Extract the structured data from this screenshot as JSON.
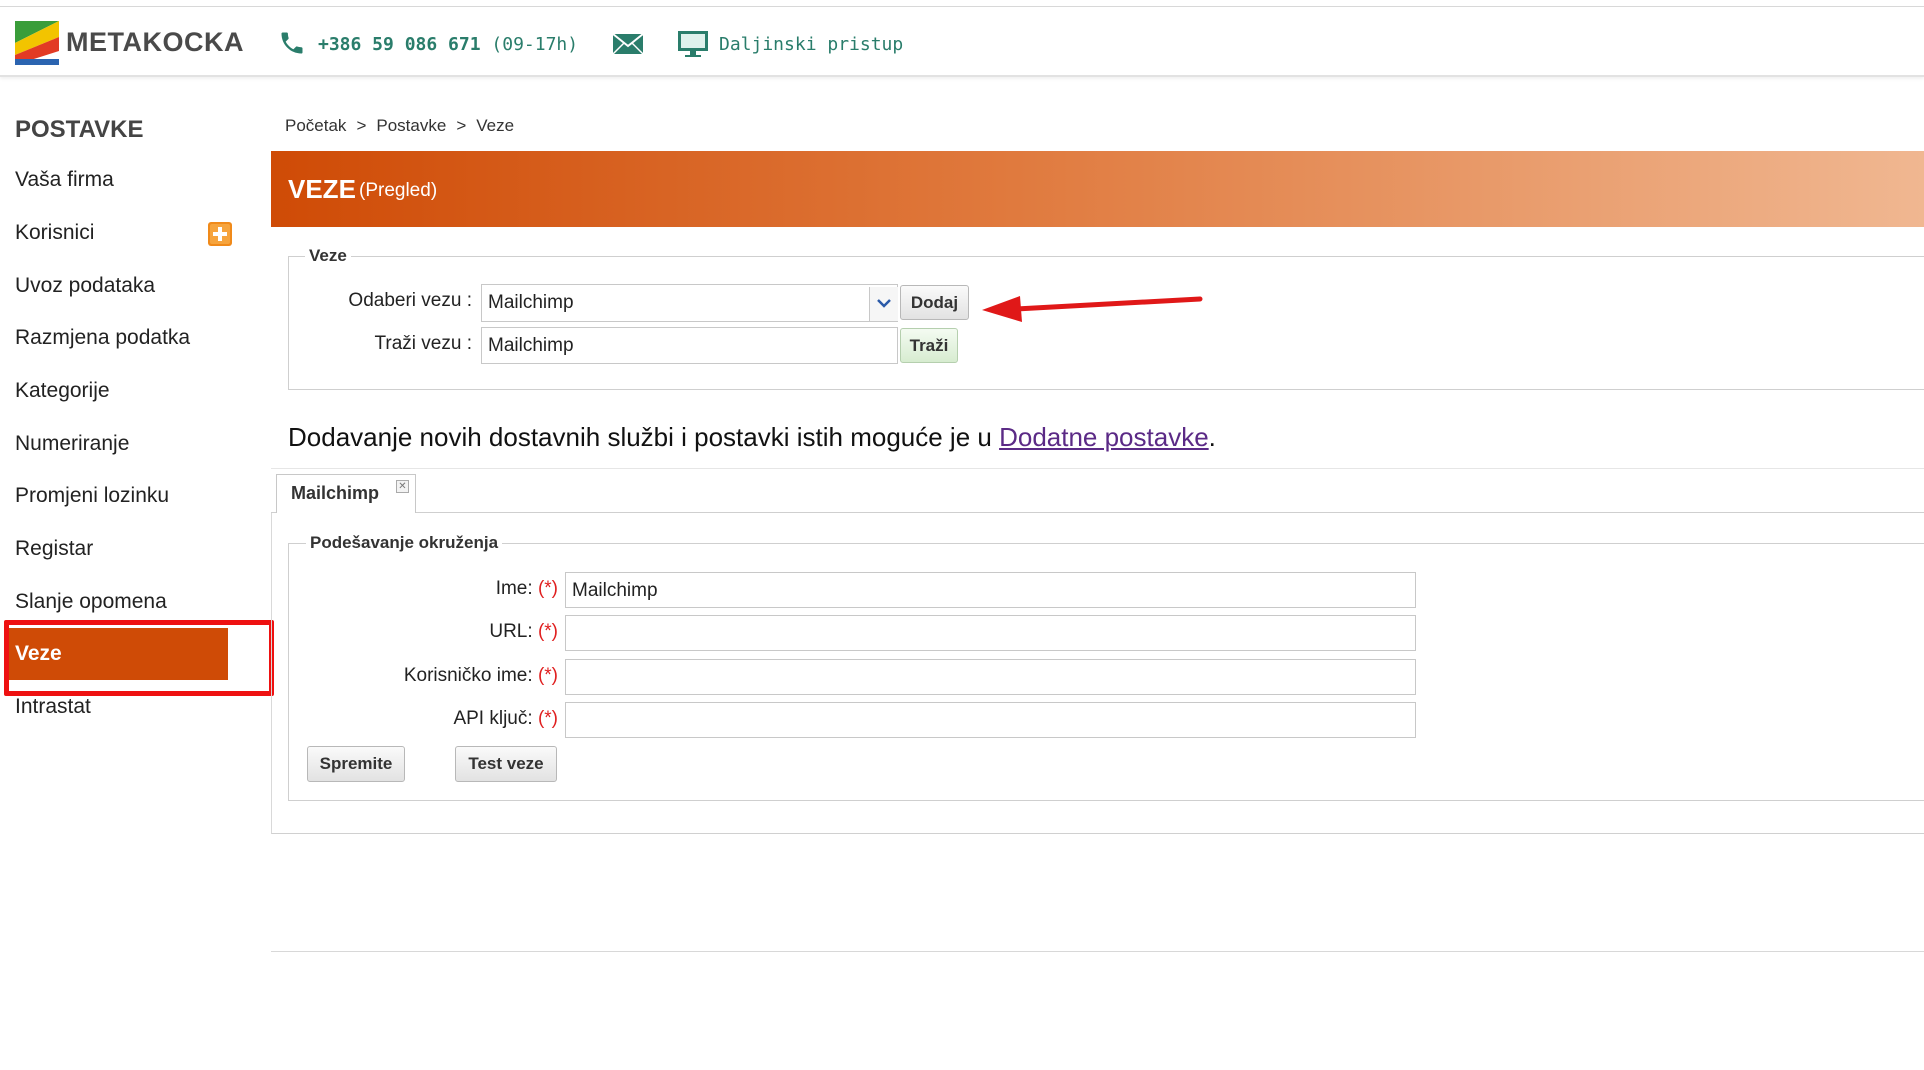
{
  "header": {
    "logo_text": "METAKOCKA",
    "phone": "+386 59 086 671",
    "phone_hours": "(09-17h)",
    "remote_label": "Daljinski pristup",
    "accent_color": "#2a7d6b"
  },
  "sidebar": {
    "title": "POSTAVKE",
    "items": [
      {
        "label": "Vaša firma"
      },
      {
        "label": "Korisnici",
        "icon": "plus-icon"
      },
      {
        "label": "Uvoz podataka"
      },
      {
        "label": "Razmjena podatka"
      },
      {
        "label": "Kategorije"
      },
      {
        "label": "Numeriranje"
      },
      {
        "label": "Promjeni lozinku"
      },
      {
        "label": "Registar"
      },
      {
        "label": "Slanje opomena"
      },
      {
        "label": "Veze",
        "active": true
      },
      {
        "label": "Intrastat"
      }
    ],
    "active_color": "#cf4b06"
  },
  "breadcrumb": [
    "Početak",
    "Postavke",
    "Veze"
  ],
  "banner": {
    "title": "VEZE",
    "subtitle": "(Pregled)"
  },
  "veze_section": {
    "legend": "Veze",
    "select_label": "Odaberi vezu :",
    "select_value": "Mailchimp",
    "add_button": "Dodaj",
    "search_label": "Traži vezu :",
    "search_value": "Mailchimp",
    "search_button": "Traži"
  },
  "info": {
    "text": "Dodavanje novih dostavnih službi i postavki istih moguće je u ",
    "link": "Dodatne postavke",
    "end": "."
  },
  "tab": {
    "label": "Mailchimp"
  },
  "settings": {
    "legend": "Podešavanje okruženja",
    "required_mark": "(*)",
    "fields": [
      {
        "label": "Ime:",
        "value": "Mailchimp"
      },
      {
        "label": "URL:",
        "value": ""
      },
      {
        "label": "Korisničko ime:",
        "value": ""
      },
      {
        "label": "API ključ:",
        "value": ""
      }
    ],
    "save_button": "Spremite",
    "test_button": "Test veze"
  }
}
